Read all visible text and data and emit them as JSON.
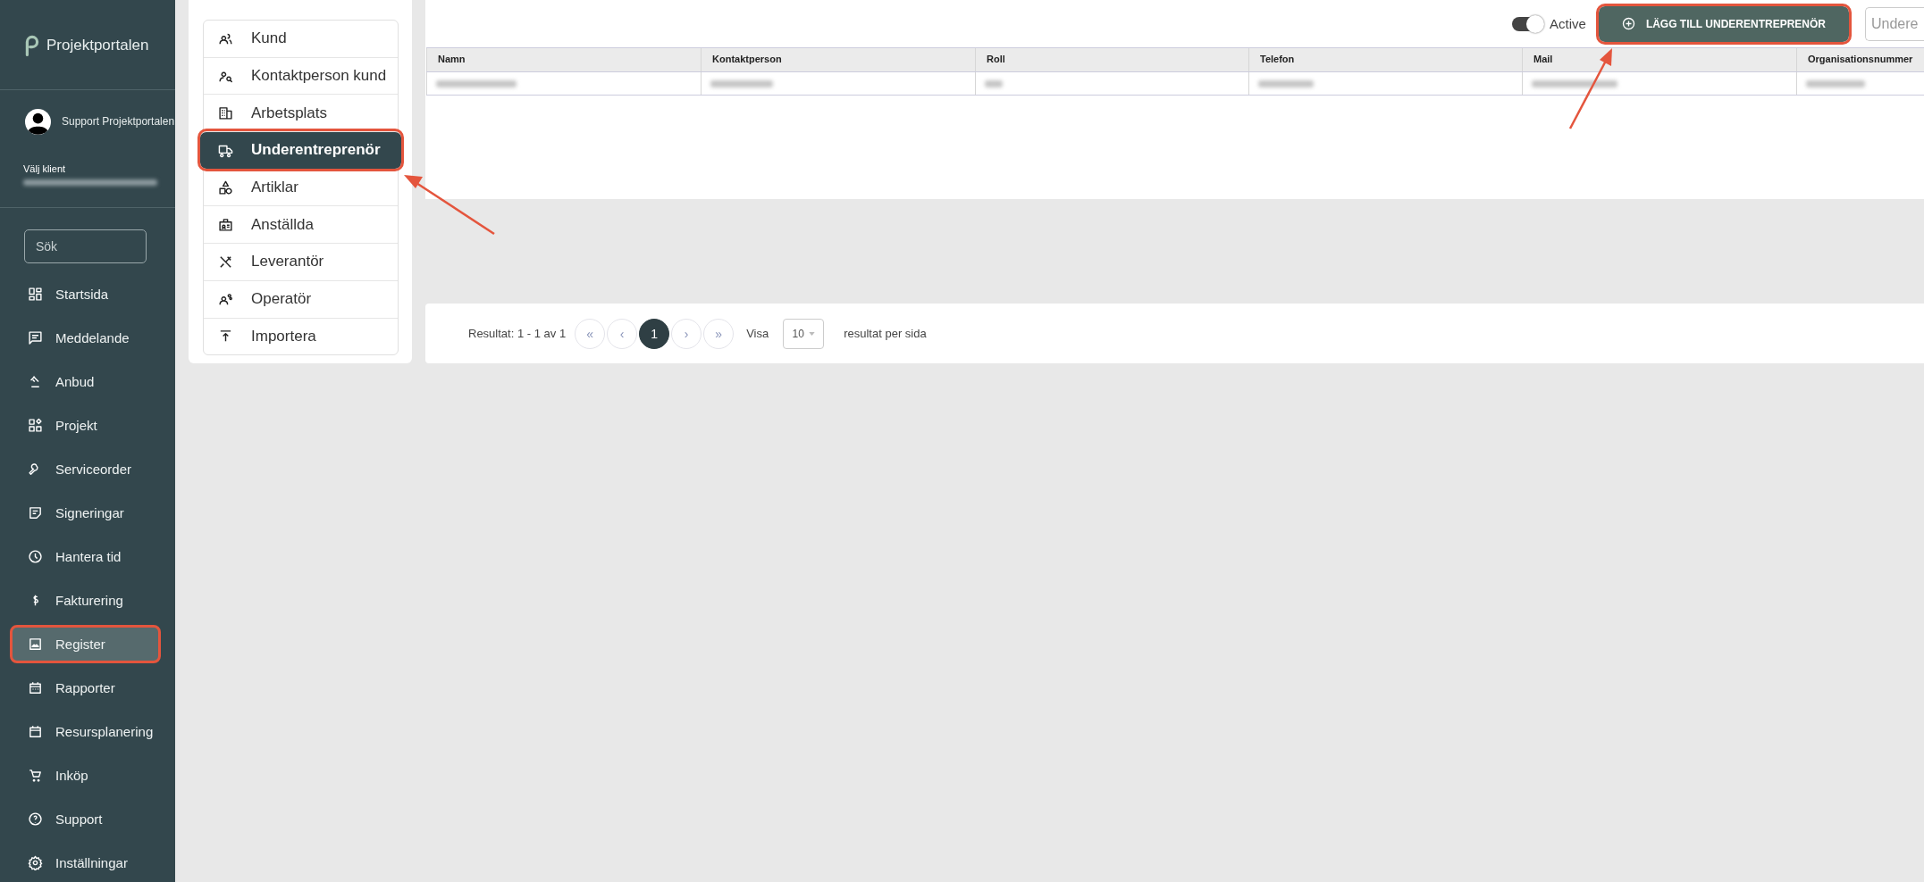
{
  "sidebar": {
    "brand": "Projektportalen",
    "user": "Support Projektportalen",
    "client_label": "Välj klient",
    "client_value": {
      "kind": "blurred"
    },
    "search": {
      "placeholder": "Sök"
    },
    "items": [
      {
        "label": "Startsida",
        "selected": false,
        "highlighted": false
      },
      {
        "label": "Meddelande",
        "selected": false,
        "highlighted": false
      },
      {
        "label": "Anbud",
        "selected": false,
        "highlighted": false
      },
      {
        "label": "Projekt",
        "selected": false,
        "highlighted": false
      },
      {
        "label": "Serviceorder",
        "selected": false,
        "highlighted": false
      },
      {
        "label": "Signeringar",
        "selected": false,
        "highlighted": false
      },
      {
        "label": "Hantera tid",
        "selected": false,
        "highlighted": false
      },
      {
        "label": "Fakturering",
        "selected": false,
        "highlighted": false
      },
      {
        "label": "Register",
        "selected": true,
        "highlighted": true
      },
      {
        "label": "Rapporter",
        "selected": false,
        "highlighted": false
      },
      {
        "label": "Resursplanering",
        "selected": false,
        "highlighted": false
      },
      {
        "label": "Inköp",
        "selected": false,
        "highlighted": false
      },
      {
        "label": "Support",
        "selected": false,
        "highlighted": false
      },
      {
        "label": "Inställningar",
        "selected": false,
        "highlighted": false
      }
    ]
  },
  "register_menu": [
    {
      "label": "Kund",
      "selected": false,
      "highlighted": false
    },
    {
      "label": "Kontaktperson kund",
      "selected": false,
      "highlighted": false
    },
    {
      "label": "Arbetsplats",
      "selected": false,
      "highlighted": false
    },
    {
      "label": "Underentreprenör",
      "selected": true,
      "highlighted": true
    },
    {
      "label": "Artiklar",
      "selected": false,
      "highlighted": false
    },
    {
      "label": "Anställda",
      "selected": false,
      "highlighted": false
    },
    {
      "label": "Leverantör",
      "selected": false,
      "highlighted": false
    },
    {
      "label": "Operatör",
      "selected": false,
      "highlighted": false
    },
    {
      "label": "Importera",
      "selected": false,
      "highlighted": false
    }
  ],
  "toolbar": {
    "active_toggle": {
      "label": "Active",
      "on": true
    },
    "add_button": {
      "label": "LÄGG TILL UNDERENTREPRENÖR",
      "highlighted": true
    },
    "search": {
      "placeholder": "Undere"
    }
  },
  "table": {
    "columns": [
      "Namn",
      "Kontaktperson",
      "Roll",
      "Telefon",
      "Mail",
      "Organisationsnummer"
    ],
    "rows": [
      {
        "cells": [
          {
            "kind": "blurred"
          },
          {
            "kind": "blurred"
          },
          {
            "kind": "blurred"
          },
          {
            "kind": "blurred"
          },
          {
            "kind": "blurred"
          },
          {
            "kind": "blurred"
          }
        ]
      }
    ]
  },
  "pagination": {
    "summary": "Resultat: 1 - 1 av 1",
    "first": "«",
    "prev": "‹",
    "pages": [
      {
        "label": "1",
        "selected": true
      }
    ],
    "next": "›",
    "last": "»",
    "show_label": "Visa",
    "page_size": "10",
    "suffix": "resultat per sida"
  }
}
